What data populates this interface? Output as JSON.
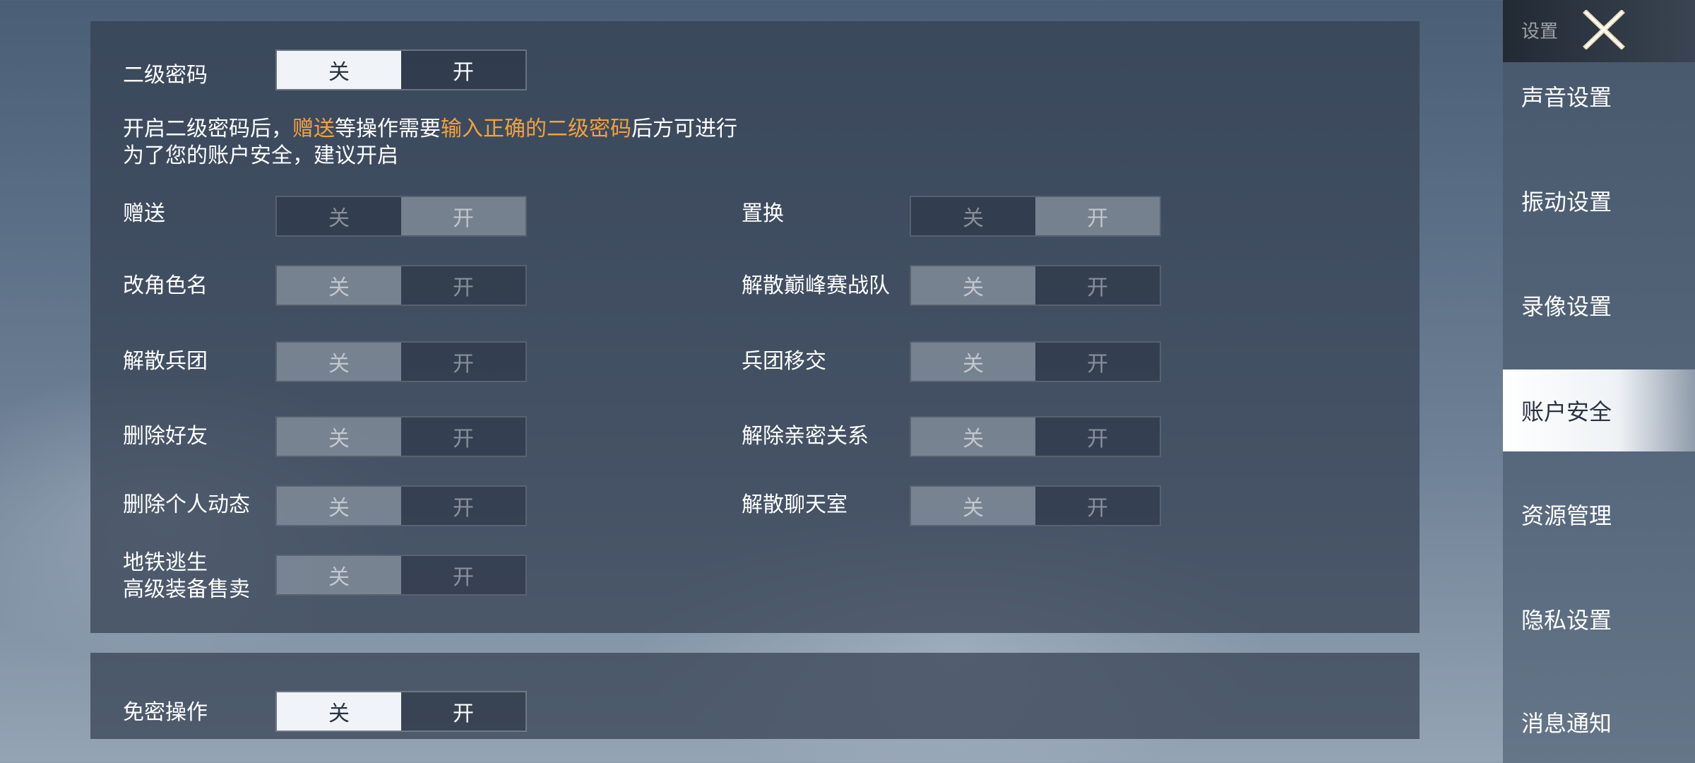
{
  "password_section": {
    "label": "二级密码",
    "toggle": {
      "off": "关",
      "on": "开",
      "selected": "off"
    },
    "desc_line1_a": "开启二级密码后，",
    "desc_line1_b": "赠送",
    "desc_line1_c": "等操作需要",
    "desc_line1_d": "输入正确的二级密码",
    "desc_line1_e": "后方可进行",
    "desc_line2": "为了您的账户安全，建议开启"
  },
  "operations": [
    {
      "label": "赠送",
      "selected": "on"
    },
    {
      "label": "置换",
      "selected": "on"
    },
    {
      "label": "改角色名",
      "selected": "off"
    },
    {
      "label": "解散巅峰赛战队",
      "selected": "off"
    },
    {
      "label": "解散兵团",
      "selected": "off"
    },
    {
      "label": "兵团移交",
      "selected": "off"
    },
    {
      "label": "删除好友",
      "selected": "off"
    },
    {
      "label": "解除亲密关系",
      "selected": "off"
    },
    {
      "label": "删除个人动态",
      "selected": "off"
    },
    {
      "label": "解散聊天室",
      "selected": "off"
    },
    {
      "label_line1": "地铁逃生",
      "label_line2": "高级装备售卖",
      "selected": "off"
    }
  ],
  "toggle_text": {
    "off": "关",
    "on": "开"
  },
  "free_section": {
    "label": "免密操作",
    "toggle": {
      "off": "关",
      "on": "开",
      "selected": "off"
    }
  },
  "sidebar": {
    "title": "设置",
    "close_icon": "close-x-icon",
    "items": [
      {
        "label": "声音设置",
        "active": false
      },
      {
        "label": "振动设置",
        "active": false
      },
      {
        "label": "录像设置",
        "active": false
      },
      {
        "label": "账户安全",
        "active": true
      },
      {
        "label": "资源管理",
        "active": false
      },
      {
        "label": "隐私设置",
        "active": false
      },
      {
        "label": "消息通知",
        "active": false
      }
    ]
  },
  "colors": {
    "highlight": "#f2a23a",
    "panel": "#344052",
    "active_tab": "#ffffff"
  }
}
